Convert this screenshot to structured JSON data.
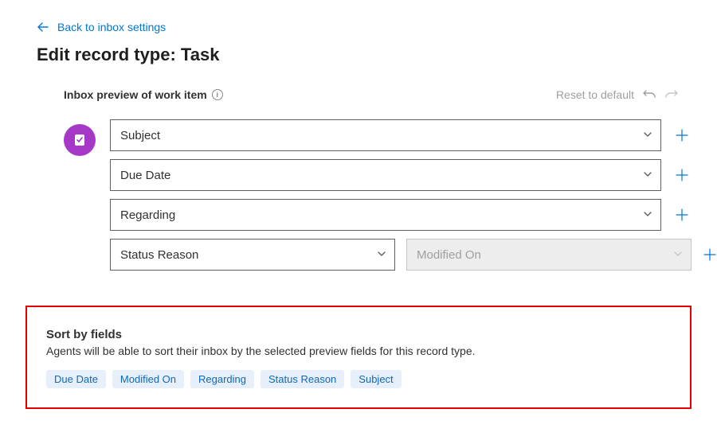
{
  "back_link": "Back to inbox settings",
  "page_title": "Edit record type: Task",
  "section": {
    "title": "Inbox preview of work item",
    "reset_label": "Reset to default"
  },
  "fields": {
    "row1": "Subject",
    "row2": "Due Date",
    "row3": "Regarding",
    "row4a": "Status Reason",
    "row4b": "Modified On"
  },
  "sort": {
    "title": "Sort by fields",
    "desc": "Agents will be able to sort their inbox by the selected preview fields for this record type.",
    "chips": [
      "Due Date",
      "Modified On",
      "Regarding",
      "Status Reason",
      "Subject"
    ]
  }
}
